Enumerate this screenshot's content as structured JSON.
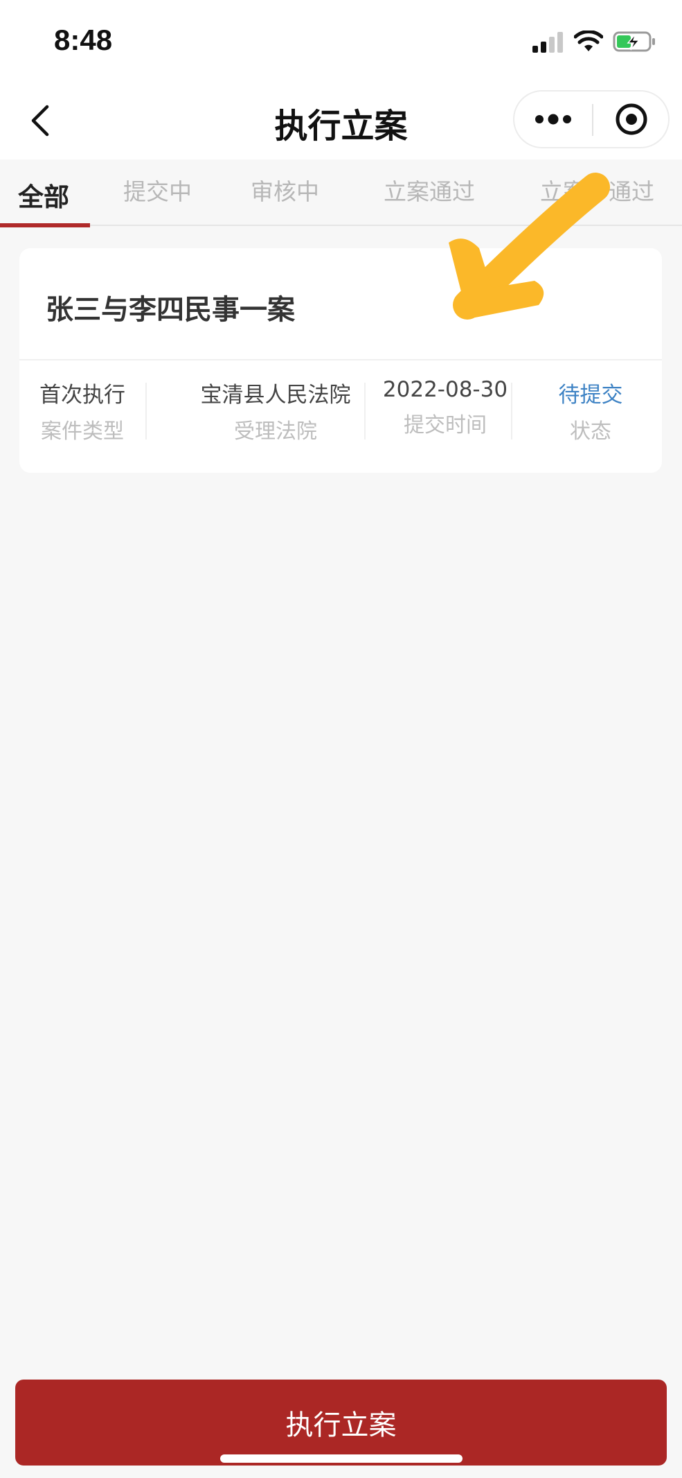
{
  "status_bar": {
    "time": "8:48",
    "icons": [
      "signal-icon",
      "wifi-icon",
      "battery-charging-icon"
    ]
  },
  "nav": {
    "title": "执行立案",
    "back_icon": "chevron-left-icon",
    "more_icon": "more-dots-icon",
    "close_icon": "target-circle-icon"
  },
  "tabs": [
    {
      "label": "全部",
      "active": true
    },
    {
      "label": "提交中",
      "active": false
    },
    {
      "label": "审核中",
      "active": false
    },
    {
      "label": "立案通过",
      "active": false
    },
    {
      "label": "立案不通过",
      "active": false
    }
  ],
  "case_card": {
    "title": "张三与李四民事一案",
    "fields": [
      {
        "value": "首次执行",
        "label": "案件类型"
      },
      {
        "value": "宝清县人民法院",
        "label": "受理法院"
      },
      {
        "value": "2022-08-30",
        "label": "提交时间"
      },
      {
        "value": "待提交",
        "label": "状态"
      }
    ]
  },
  "primary_button": {
    "label": "执行立案"
  },
  "colors": {
    "brand_red": "#ab2725",
    "status_blue": "#3d82c4",
    "annotation_arrow": "#fbb829",
    "page_bg": "#f7f7f7"
  }
}
